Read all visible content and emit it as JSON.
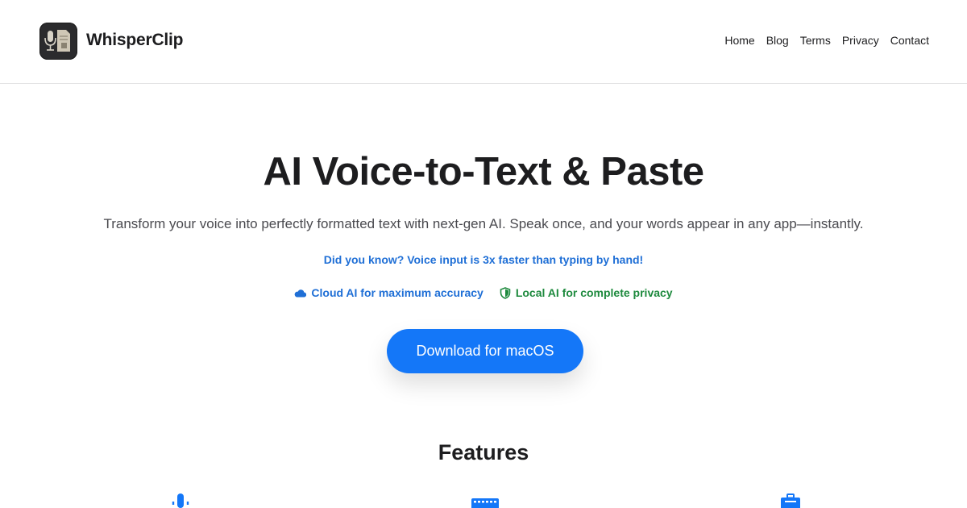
{
  "header": {
    "brand": "WhisperClip",
    "logo_icon": "microphone-document-icon",
    "nav": [
      {
        "label": "Home"
      },
      {
        "label": "Blog"
      },
      {
        "label": "Terms"
      },
      {
        "label": "Privacy"
      },
      {
        "label": "Contact"
      }
    ]
  },
  "hero": {
    "title": "AI Voice-to-Text & Paste",
    "subtitle": "Transform your voice into perfectly formatted text with next-gen AI. Speak once, and your words appear in any app—instantly.",
    "fact": "Did you know? Voice input is 3x faster than typing by hand!",
    "badges": {
      "cloud": {
        "label": "Cloud AI for maximum accuracy",
        "icon": "cloud-icon",
        "color": "#1f6fd6"
      },
      "local": {
        "label": "Local AI for complete privacy",
        "icon": "shield-icon",
        "color": "#1e8a3e"
      }
    },
    "download_label": "Download for macOS",
    "accent": "#1477f8"
  },
  "features": {
    "title": "Features",
    "icons": [
      "microphone-icon",
      "keyboard-icon",
      "clipboard-icon"
    ]
  }
}
